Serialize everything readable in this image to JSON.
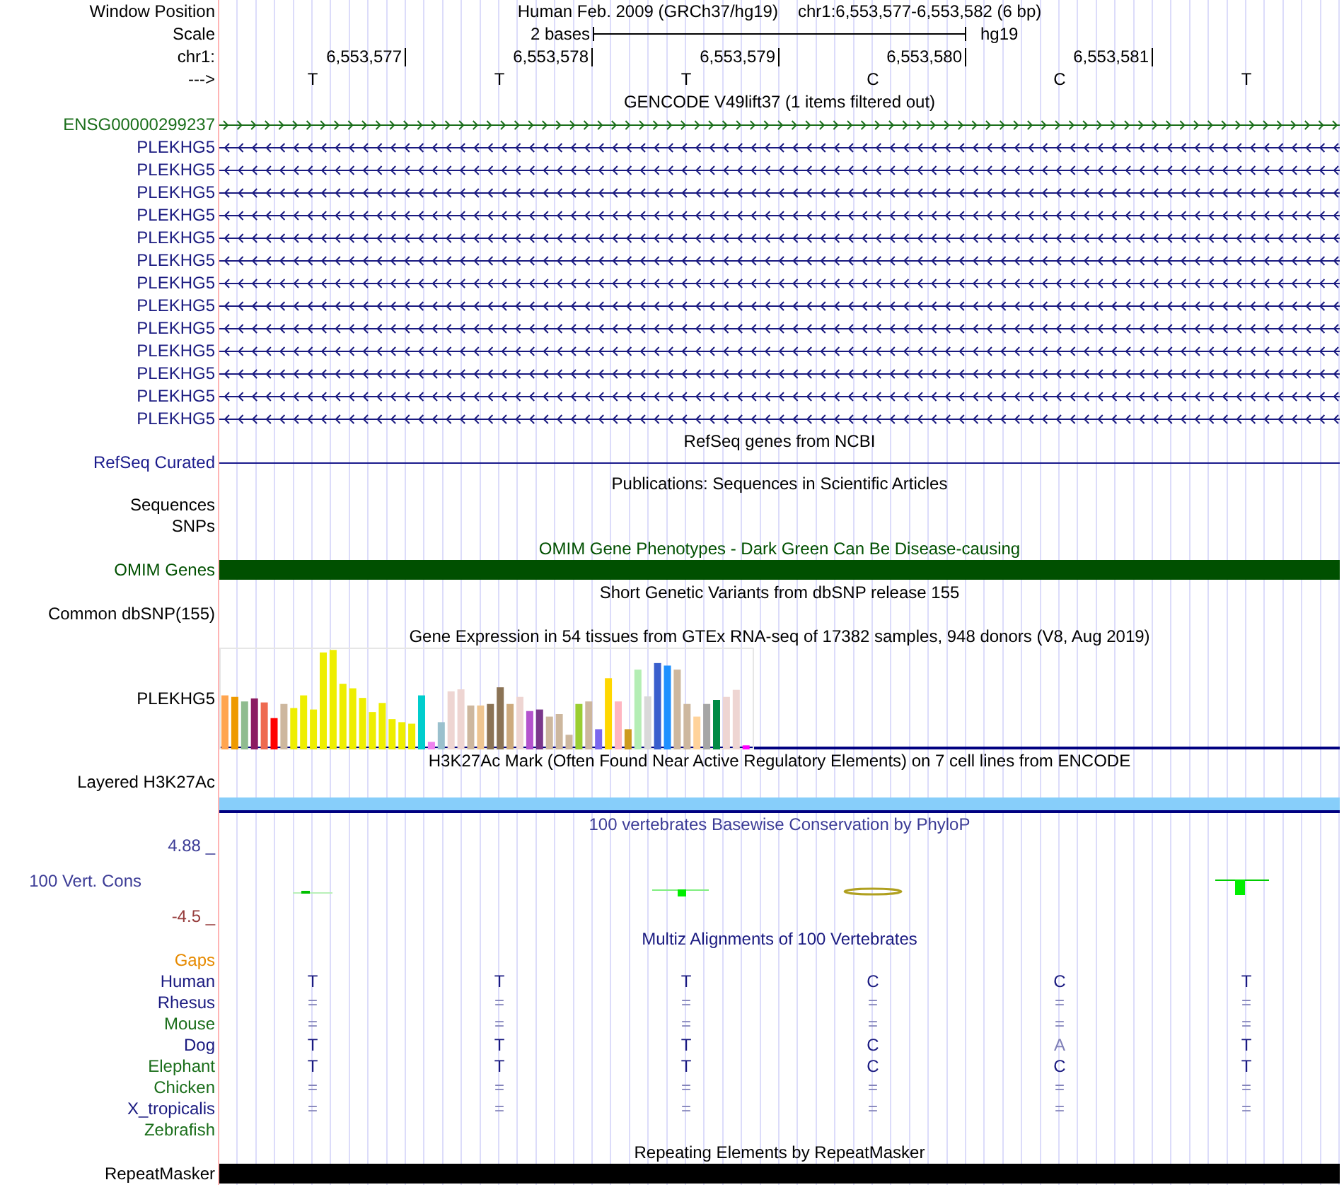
{
  "header": {
    "window_position_label": "Window Position",
    "assembly": "Human Feb. 2009 (GRCh37/hg19)",
    "position": "chr1:6,553,577-6,553,582 (6 bp)",
    "scale_label": "Scale",
    "scale_text": "2 bases",
    "scale_db": "hg19",
    "chrom_label": "chr1:",
    "positions": [
      "6,553,577",
      "6,553,578",
      "6,553,579",
      "6,553,580",
      "6,553,581"
    ],
    "strand_label": "--->",
    "bases": [
      "T",
      "T",
      "T",
      "C",
      "C",
      "T"
    ]
  },
  "tracks": [
    {
      "kind": "genes",
      "title": "GENCODE V49lift37 (1 items filtered out)",
      "genes": [
        {
          "name": "ENSG00000299237",
          "reverse": false,
          "color": "#1a6e1a"
        },
        {
          "name": "PLEKHG5",
          "reverse": true,
          "color": "#1a1a80"
        },
        {
          "name": "PLEKHG5",
          "reverse": true,
          "color": "#1a1a80"
        },
        {
          "name": "PLEKHG5",
          "reverse": true,
          "color": "#1a1a80"
        },
        {
          "name": "PLEKHG5",
          "reverse": true,
          "color": "#1a1a80"
        },
        {
          "name": "PLEKHG5",
          "reverse": true,
          "color": "#1a1a80"
        },
        {
          "name": "PLEKHG5",
          "reverse": true,
          "color": "#1a1a80"
        },
        {
          "name": "PLEKHG5",
          "reverse": true,
          "color": "#1a1a80"
        },
        {
          "name": "PLEKHG5",
          "reverse": true,
          "color": "#1a1a80"
        },
        {
          "name": "PLEKHG5",
          "reverse": true,
          "color": "#1a1a80"
        },
        {
          "name": "PLEKHG5",
          "reverse": true,
          "color": "#1a1a80"
        },
        {
          "name": "PLEKHG5",
          "reverse": true,
          "color": "#1a1a80"
        },
        {
          "name": "PLEKHG5",
          "reverse": true,
          "color": "#1a1a80"
        },
        {
          "name": "PLEKHG5",
          "reverse": true,
          "color": "#1a1a80"
        }
      ]
    },
    {
      "kind": "line",
      "title": "RefSeq genes from NCBI",
      "label": "RefSeq Curated",
      "color": "#1a1a8c"
    },
    {
      "kind": "labels",
      "title": "Publications: Sequences in Scientific Articles",
      "labels": [
        "Sequences",
        "SNPs"
      ]
    },
    {
      "kind": "bar",
      "title": "OMIM Gene Phenotypes - Dark Green Can Be Disease-causing",
      "label": "OMIM Genes",
      "color": "#005000"
    },
    {
      "kind": "labels",
      "title": "Short Genetic Variants from dbSNP release 155",
      "labels": [
        "Common dbSNP(155)"
      ]
    },
    {
      "kind": "expression",
      "title": "Gene Expression in 54 tissues from GTEx RNA-seq of 17382 samples, 948 donors (V8, Aug 2019)",
      "label": "PLEKHG5"
    },
    {
      "kind": "layered",
      "title": "H3K27Ac Mark (Often Found Near Active Regulatory Elements) on 7 cell lines from ENCODE",
      "label": "Layered H3K27Ac",
      "color": "#87cefa"
    },
    {
      "kind": "conservation",
      "title": "100 vertebrates Basewise Conservation by PhyloP",
      "label": "100 Vert. Cons",
      "max_label": "4.88 _",
      "min_label": "-4.5 _"
    },
    {
      "kind": "alignment",
      "title": "Multiz Alignments of 100 Vertebrates",
      "gaps_label": "Gaps",
      "species": [
        {
          "name": "Human",
          "color": "#1a1a80",
          "bases": [
            "T",
            "T",
            "T",
            "C",
            "C",
            "T"
          ]
        },
        {
          "name": "Rhesus",
          "color": "#1a1a80",
          "bases": [
            "=",
            "=",
            "=",
            "=",
            "=",
            "="
          ]
        },
        {
          "name": "Mouse",
          "color": "#1a6e1a",
          "bases": [
            "=",
            "=",
            "=",
            "=",
            "=",
            "="
          ]
        },
        {
          "name": "Dog",
          "color": "#1a1a80",
          "bases": [
            "T",
            "T",
            "T",
            "C",
            "A",
            "T"
          ]
        },
        {
          "name": "Elephant",
          "color": "#1a6e1a",
          "bases": [
            "T",
            "T",
            "T",
            "C",
            "C",
            "T"
          ]
        },
        {
          "name": "Chicken",
          "color": "#1a6e1a",
          "bases": [
            "=",
            "=",
            "=",
            "=",
            "=",
            "="
          ]
        },
        {
          "name": "X_tropicalis",
          "color": "#1a1a80",
          "bases": [
            "=",
            "=",
            "=",
            "=",
            "=",
            "="
          ]
        },
        {
          "name": "Zebrafish",
          "color": "#1a6e1a"
        }
      ]
    },
    {
      "kind": "bar",
      "title": "Repeating Elements by RepeatMasker",
      "label": "RepeatMasker",
      "color": "#000000"
    }
  ]
}
